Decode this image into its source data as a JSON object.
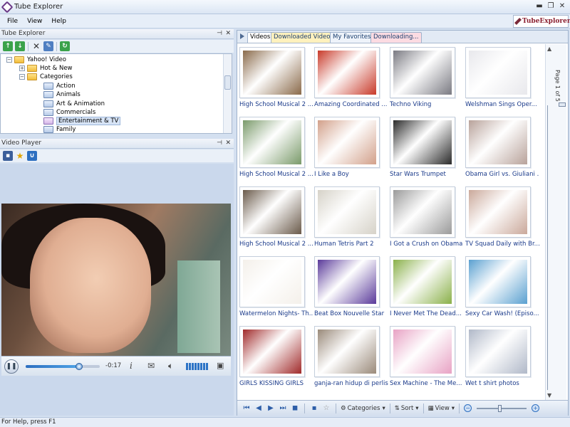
{
  "window": {
    "title": "Tube Explorer"
  },
  "menu": {
    "items": [
      "File",
      "View",
      "Help"
    ]
  },
  "brand": {
    "text": "TubeExplorer"
  },
  "explorer_panel": {
    "title": "Tube Explorer",
    "tree": {
      "root": "Yahoo! Video",
      "hot_new": "Hot & New",
      "categories": "Categories",
      "items": [
        "Action",
        "Animals",
        "Art & Animation",
        "Commercials",
        "Entertainment & TV",
        "Family"
      ],
      "selected": "Entertainment & TV"
    }
  },
  "player_panel": {
    "title": "Video Player",
    "time": "-0:17",
    "progress_fraction": 0.72
  },
  "tabs": [
    "Videos",
    "Downloaded Videos",
    "My Favorites",
    "Downloading..."
  ],
  "videos": [
    [
      "High School Musical 2 ...",
      "Amazing Coordinated ...",
      "Techno Viking",
      "Welshman Sings Oper..."
    ],
    [
      "High School Musical 2 ...",
      "I Like a Boy",
      "Star Wars Trumpet",
      "Obama Girl vs. Giuliani ..."
    ],
    [
      "High School Musical 2 ...",
      "Human Tetris Part 2",
      "I Got a Crush on Obama",
      "TV Squad Daily with Br..."
    ],
    [
      "Watermelon Nights- Th...",
      "Beat Box Nouvelle Star",
      "I Never Met The Dead...",
      "Sexy Car Wash! (Episo..."
    ],
    [
      "GIRLS KISSING GIRLS",
      "ganja-ran hidup di perlis",
      "Sex Machine - The Me...",
      "Wet t shirt photos"
    ]
  ],
  "thumb_colors": [
    [
      "#8a6a4a",
      "#c83a2a",
      "#7a7a82",
      "#e8e8ec"
    ],
    [
      "#7a9a6a",
      "#d2a08a",
      "#2a2a2a",
      "#b8a29a"
    ],
    [
      "#6a5a4a",
      "#d6d2c8",
      "#9a9a9a",
      "#caa89a"
    ],
    [
      "#f4f0ea",
      "#5a3a9a",
      "#8ab04a",
      "#5aa0d0"
    ],
    [
      "#a02a2a",
      "#9a8a7a",
      "#e8a2c4",
      "#b0b8c8"
    ]
  ],
  "pager": {
    "label": "Page 1 of 5"
  },
  "bottom_bar": {
    "categories": "Categories",
    "sort": "Sort",
    "view": "View"
  },
  "status": {
    "text": "For Help, press F1"
  }
}
